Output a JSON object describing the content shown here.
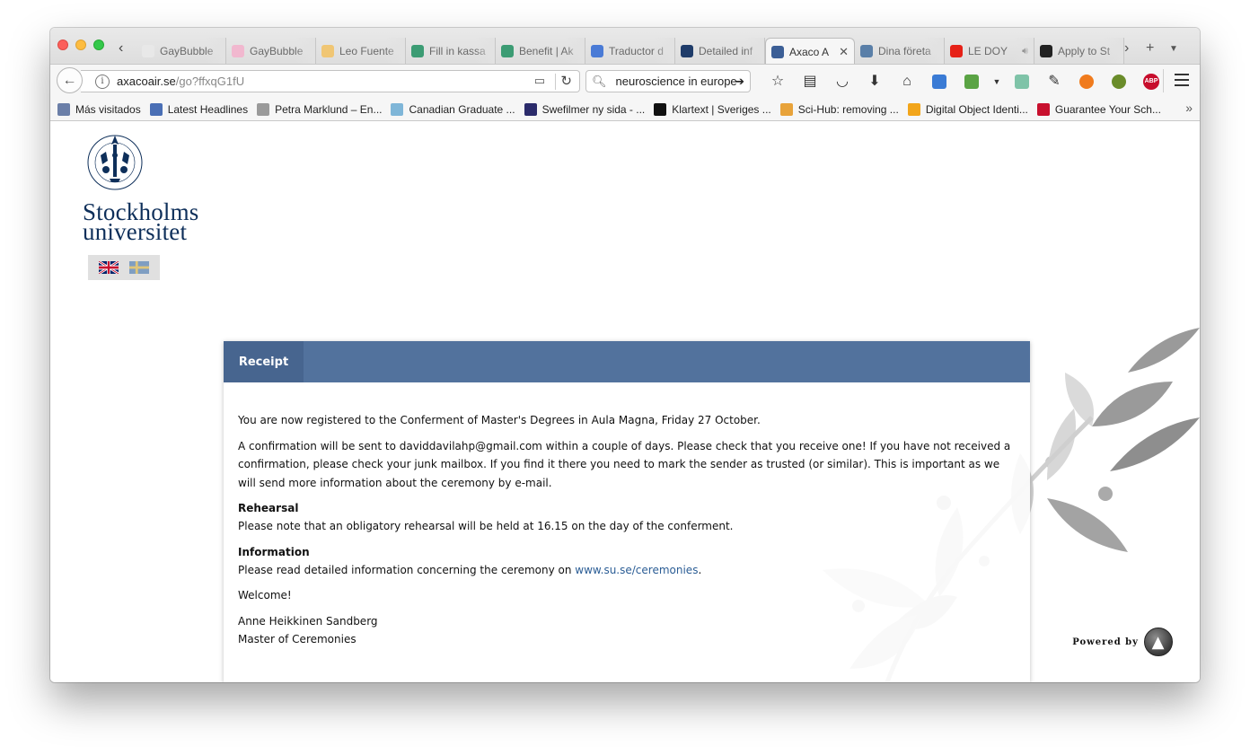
{
  "browser": {
    "tabs": [
      {
        "label": "GayBubble",
        "fav_color": "#e8e8e8",
        "active": false
      },
      {
        "label": "GayBubble",
        "fav_color": "#f1b8cf",
        "active": false
      },
      {
        "label": "Leo Fuente",
        "fav_color": "#f0c674",
        "active": false
      },
      {
        "label": "Fill in kassa",
        "fav_color": "#3c9c74",
        "active": false
      },
      {
        "label": "Benefit | Ak",
        "fav_color": "#3c9c74",
        "active": false
      },
      {
        "label": "Traductor d",
        "fav_color": "#4a7bd6",
        "active": false
      },
      {
        "label": "Detailed inf",
        "fav_color": "#1f3c6a",
        "active": false
      },
      {
        "label": "Axaco A",
        "fav_color": "#3c5f96",
        "active": true
      },
      {
        "label": "Dina företa",
        "fav_color": "#5a7fa8",
        "active": false
      },
      {
        "label": "LE DOY",
        "fav_color": "#e62117",
        "active": false
      },
      {
        "label": "Apply to St",
        "fav_color": "#222222",
        "active": false
      }
    ],
    "url_domain": "axacoair.se",
    "url_path": "/go?ffxqG1fU",
    "search_value": "neuroscience in europe",
    "bookmarks": [
      {
        "label": "Más visitados",
        "fav_color": "#6b7fa8"
      },
      {
        "label": "Latest Headlines",
        "fav_color": "#4a6fb5"
      },
      {
        "label": "Petra Marklund – En...",
        "fav_color": "#9a9a9a"
      },
      {
        "label": "Canadian Graduate ...",
        "fav_color": "#7fb6d8"
      },
      {
        "label": "Swefilmer ny sida - ...",
        "fav_color": "#2b2b6b"
      },
      {
        "label": "Klartext | Sveriges ...",
        "fav_color": "#111111"
      },
      {
        "label": "Sci-Hub: removing ...",
        "fav_color": "#e8a33a"
      },
      {
        "label": "Digital Object Identi...",
        "fav_color": "#f2a51a"
      },
      {
        "label": "Guarantee Your Sch...",
        "fav_color": "#c8102e"
      }
    ]
  },
  "page": {
    "logo_line1": "Stockholms",
    "logo_line2": "universitet",
    "receipt_tab": "Receipt",
    "para1": "You are now registered to the Conferment of Master's Degrees in Aula Magna, Friday 27 October.",
    "para2": "A confirmation will be sent to daviddavilahp@gmail.com within a couple of days. Please check that you receive one! If you have not received a confirmation, please check your junk mailbox. If you find it there you need to mark the sender as trusted (or similar). This is important as we will send more information about the ceremony by e-mail.",
    "rehearsal_heading": "Rehearsal",
    "rehearsal_text": "Please note that an obligatory rehearsal will be held at 16.15 on the day of the conferment.",
    "info_heading": "Information",
    "info_text_before": "Please read detailed information concerning the ceremony on ",
    "info_link": "www.su.se/ceremonies",
    "info_text_after": ".",
    "welcome": "Welcome!",
    "signature_name": "Anne Heikkinen Sandberg",
    "signature_title": "Master of Ceremonies",
    "powered_by": "Powered by"
  },
  "colors": {
    "header_blue": "#52729d",
    "logo_navy": "#0e2f5a",
    "link": "#2b5d95"
  }
}
